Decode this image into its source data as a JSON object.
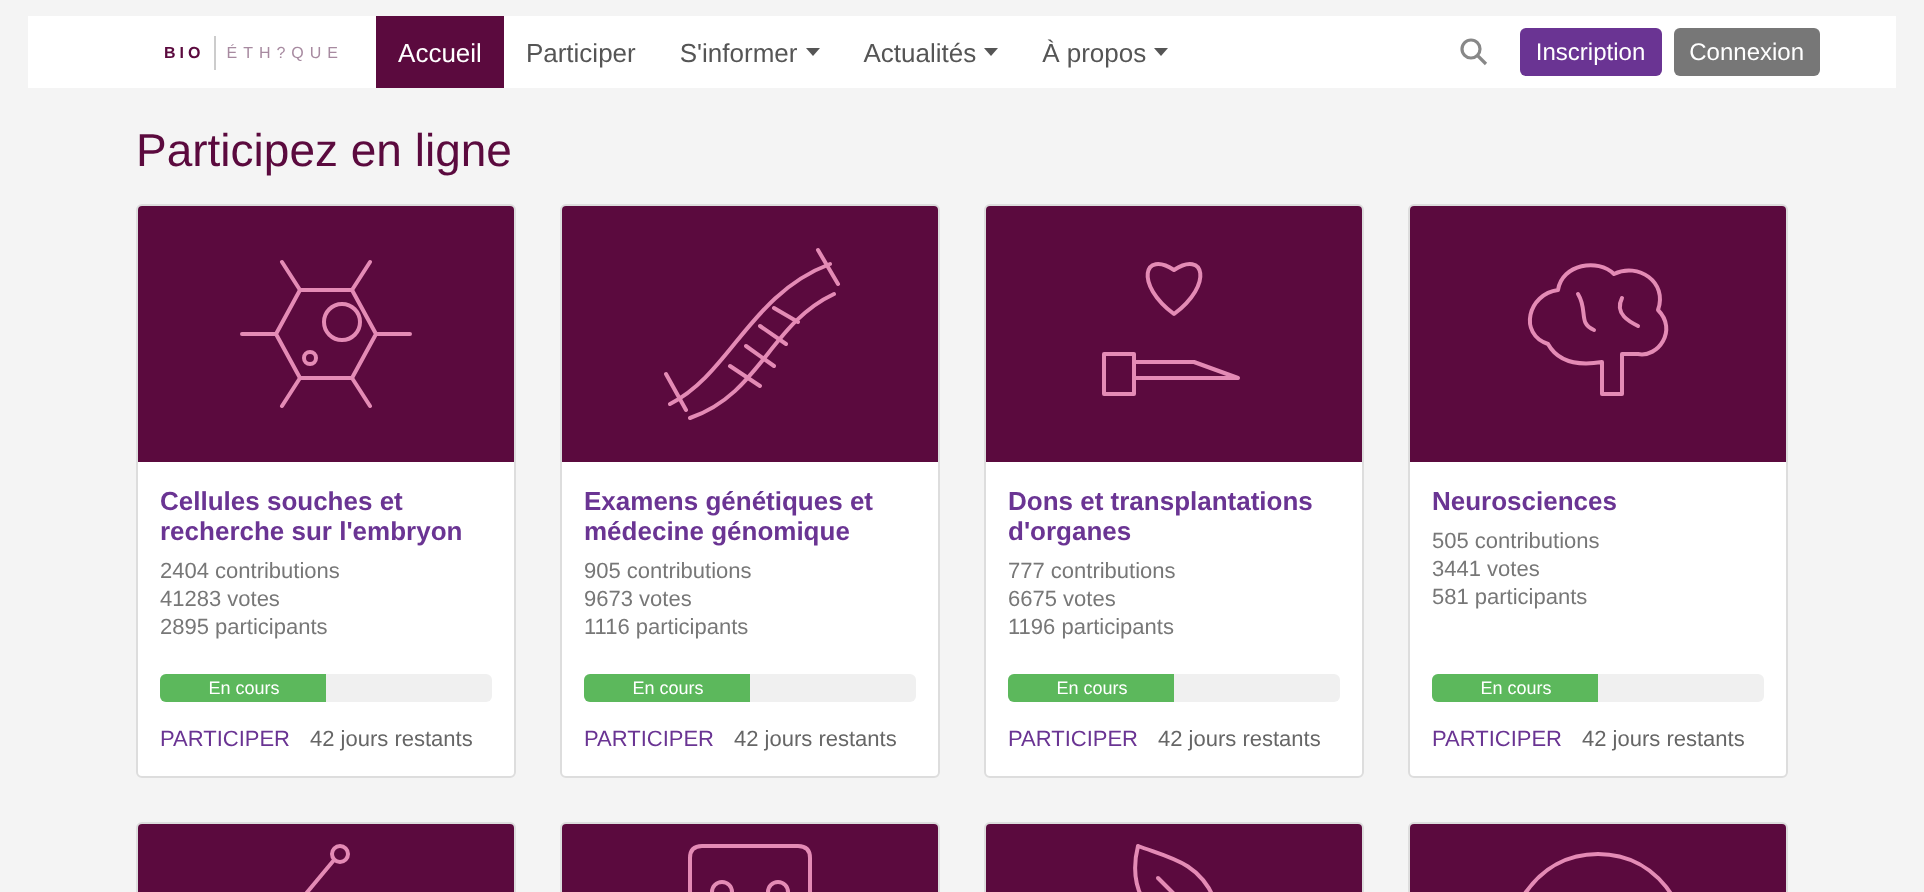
{
  "logo": {
    "left": "BIO",
    "right": "ÉTH?QUE"
  },
  "nav": [
    {
      "label": "Accueil",
      "selected": true,
      "dropdown": false
    },
    {
      "label": "Participer",
      "selected": false,
      "dropdown": false
    },
    {
      "label": "S'informer",
      "selected": false,
      "dropdown": true
    },
    {
      "label": "Actualités",
      "selected": false,
      "dropdown": true
    },
    {
      "label": "À propos",
      "selected": false,
      "dropdown": true
    }
  ],
  "buttons": [
    {
      "label": "Inscription",
      "kind": "primary"
    },
    {
      "label": "Connexion",
      "kind": "secondary"
    }
  ],
  "heading": "Participez en ligne",
  "cards": [
    {
      "title": "Cellules souches et recherche sur l'embryon",
      "stats": [
        "2404 contributions",
        "41283 votes",
        "2895 participants"
      ],
      "status": "En cours",
      "level": 0.5,
      "link": "PARTICIPER",
      "remaining": "42 jours restants"
    },
    {
      "title": "Examens génétiques et médecine génomique",
      "stats": [
        "905 contributions",
        "9673 votes",
        "1116 participants"
      ],
      "status": "En cours",
      "level": 0.5,
      "link": "PARTICIPER",
      "remaining": "42 jours restants"
    },
    {
      "title": "Dons et transplantations d'organes",
      "stats": [
        "777 contributions",
        "6675 votes",
        "1196 participants"
      ],
      "status": "En cours",
      "level": 0.5,
      "link": "PARTICIPER",
      "remaining": "42 jours restants"
    },
    {
      "title": "Neurosciences",
      "stats": [
        "505 contributions",
        "3441 votes",
        "581 participants"
      ],
      "status": "En cours",
      "level": 0.5,
      "link": "PARTICIPER",
      "remaining": "42 jours restants"
    }
  ]
}
